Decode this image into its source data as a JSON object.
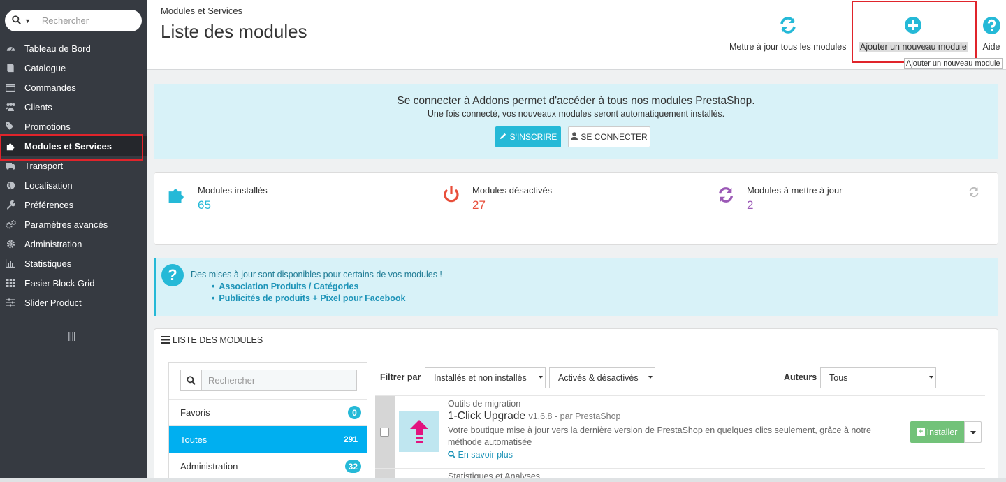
{
  "sidebar": {
    "search_placeholder": "Rechercher",
    "items": [
      {
        "label": "Tableau de Bord",
        "icon": "dashboard-icon"
      },
      {
        "label": "Catalogue",
        "icon": "book-icon"
      },
      {
        "label": "Commandes",
        "icon": "credit-card-icon"
      },
      {
        "label": "Clients",
        "icon": "users-icon"
      },
      {
        "label": "Promotions",
        "icon": "tags-icon"
      },
      {
        "label": "Modules et Services",
        "icon": "puzzle-icon"
      },
      {
        "label": "Transport",
        "icon": "truck-icon"
      },
      {
        "label": "Localisation",
        "icon": "globe-icon"
      },
      {
        "label": "Préférences",
        "icon": "wrench-icon"
      },
      {
        "label": "Paramètres avancés",
        "icon": "gears-icon"
      },
      {
        "label": "Administration",
        "icon": "gear-icon"
      },
      {
        "label": "Statistiques",
        "icon": "bar-chart-icon"
      },
      {
        "label": "Easier Block Grid",
        "icon": "grid-icon"
      },
      {
        "label": "Slider Product",
        "icon": "sliders-icon"
      }
    ],
    "active_index": 5
  },
  "header": {
    "breadcrumb": "Modules et Services",
    "title": "Liste des modules",
    "update_all_label": "Mettre à jour tous les modules",
    "add_module_label": "Ajouter un nouveau module",
    "help_label": "Aide",
    "tooltip": "Ajouter un nouveau module"
  },
  "addons": {
    "title": "Se connecter à Addons permet d'accéder à tous nos modules PrestaShop.",
    "subtitle": "Une fois connecté, vos nouveaux modules seront automatiquement installés.",
    "signup_label": "S'INSCRIRE",
    "login_label": "SE CONNECTER"
  },
  "stats": {
    "installed": {
      "label": "Modules installés",
      "value": "65",
      "color": "#25b9d7"
    },
    "disabled": {
      "label": "Modules désactivés",
      "value": "27",
      "color": "#e84e3a"
    },
    "to_update": {
      "label": "Modules à mettre à jour",
      "value": "2",
      "color": "#9b59b6"
    }
  },
  "updates": {
    "text": "Des mises à jour sont disponibles pour certains de vos modules !",
    "items": [
      "Association Produits / Catégories",
      "Publicités de produits + Pixel pour Facebook"
    ]
  },
  "module_list": {
    "heading": "LISTE DES MODULES",
    "search_placeholder": "Rechercher",
    "categories": [
      {
        "label": "Favoris",
        "count": "0"
      },
      {
        "label": "Toutes",
        "count": "291"
      },
      {
        "label": "Administration",
        "count": "32"
      }
    ],
    "filter_label": "Filtrer par",
    "filter_install": "Installés et non installés",
    "filter_active": "Activés & désactivés",
    "authors_label": "Auteurs",
    "authors_value": "Tous",
    "modules": [
      {
        "category": "Outils de migration",
        "name": "1-Click Upgrade",
        "version": "v1.6.8 - par PrestaShop",
        "description": "Votre boutique mise à jour vers la dernière version de PrestaShop en quelques clics seulement, grâce à notre méthode automatisée",
        "more_label": "En savoir plus",
        "install_label": "Installer"
      }
    ],
    "next_category": "Statistiques et Analyses"
  },
  "colors": {
    "sidebar_bg": "#363a41",
    "accent": "#25b9d7",
    "install_green": "#72c279",
    "highlight_red": "#e0242b"
  }
}
